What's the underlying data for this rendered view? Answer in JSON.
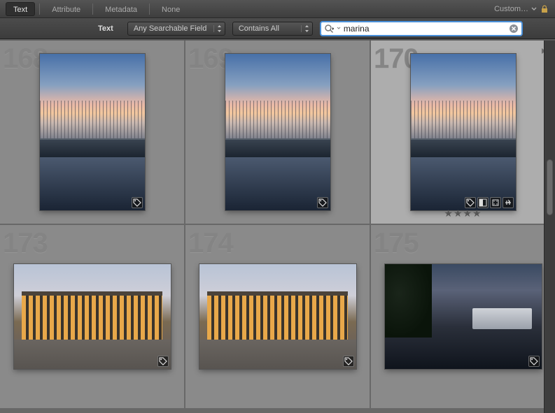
{
  "topbar": {
    "tabs": [
      {
        "label": "Text",
        "active": true
      },
      {
        "label": "Attribute",
        "active": false
      },
      {
        "label": "Metadata",
        "active": false
      },
      {
        "label": "None",
        "active": false
      }
    ],
    "custom_label": "Custom…"
  },
  "filter": {
    "section_label": "Text",
    "field_dropdown": "Any Searchable Field",
    "rule_dropdown": "Contains All",
    "search_value": "marina",
    "search_placeholder": ""
  },
  "grid": {
    "cells": [
      {
        "num": "168",
        "kind": "marina",
        "orient": "portrait",
        "selected": false,
        "stars": 0,
        "badges": [
          "tag"
        ]
      },
      {
        "num": "169",
        "kind": "marina",
        "orient": "portrait",
        "selected": false,
        "stars": 0,
        "badges": [
          "tag"
        ]
      },
      {
        "num": "170",
        "kind": "marina",
        "orient": "portrait",
        "selected": true,
        "stars": 4,
        "badges": [
          "tag",
          "bw",
          "crop",
          "adjust"
        ]
      },
      {
        "num": "173",
        "kind": "building",
        "orient": "landscape",
        "selected": false,
        "stars": 0,
        "badges": [
          "tag"
        ]
      },
      {
        "num": "174",
        "kind": "building",
        "orient": "landscape",
        "selected": false,
        "stars": 0,
        "badges": [
          "tag"
        ]
      },
      {
        "num": "175",
        "kind": "dock",
        "orient": "landscape",
        "selected": false,
        "stars": 0,
        "badges": [
          "tag"
        ]
      }
    ]
  }
}
